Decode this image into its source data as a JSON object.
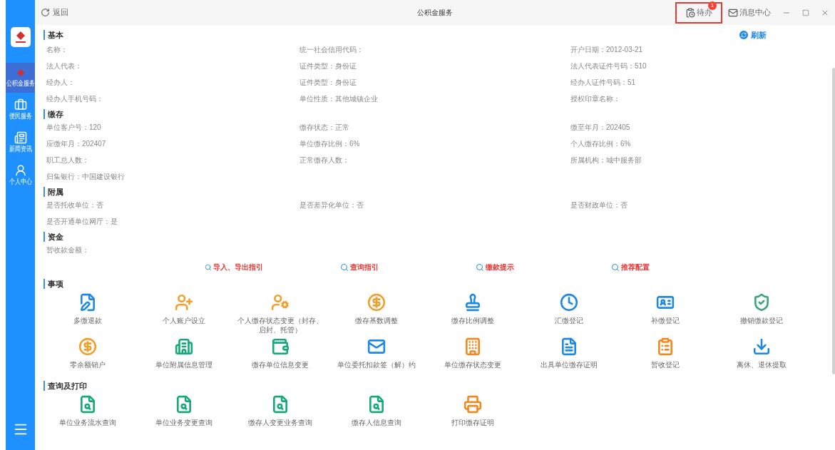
{
  "top_bar": {
    "back_label": "返回",
    "title": "公积金服务",
    "todo": {
      "label": "待办",
      "badge": "1",
      "highlighted": true
    },
    "messages_label": "消息中心"
  },
  "sidebar": {
    "items": [
      {
        "label": "公积金服务",
        "selected": true
      },
      {
        "label": "便民服务",
        "selected": false
      },
      {
        "label": "新闻资讯",
        "selected": false
      },
      {
        "label": "个人中心",
        "selected": false
      }
    ]
  },
  "sections": [
    {
      "title": "基本",
      "action": "刷新",
      "fields": [
        "名称：",
        "统一社会信用代码：",
        "开户日期：2012-03-21",
        "法人代表：",
        "证件类型：身份证",
        "法人代表证件号码：510",
        "经办人：",
        "证件类型：身份证",
        "经办人证件号码：51",
        "经办人手机号码：",
        "单位性质：其他城镇企业",
        "授权印章名称："
      ]
    },
    {
      "title": "缴存",
      "fields": [
        "单位客户号：120",
        "缴存状态：正常",
        "缴至年月：202405",
        "应缴年月：202407",
        "单位缴存比例：6%",
        "个人缴存比例：6%",
        "职工总人数：",
        "正常缴存人数：",
        "所属机构：城中服务部",
        "归集银行：中国建设银行"
      ]
    },
    {
      "title": "附属",
      "fields": [
        "是否托收单位：否",
        "是否差异化单位：否",
        "是否财政单位：否",
        "是否开通单位网厅：是"
      ]
    },
    {
      "title": "资金",
      "fields": [
        "暂收款金额："
      ],
      "links": [
        "导入、导出指引",
        "查询指引",
        "缴款提示",
        "推荐配置"
      ]
    },
    {
      "title": "事项",
      "tiles": [
        "多缴退款",
        "个人账户设立",
        "个人缴存状态变更（封存、启封、托管）",
        "缴存基数调整",
        "缴存比例调整",
        "汇缴登记",
        "补缴登记",
        "撤销缴款登记",
        "零余额销户",
        "单位附属信息管理",
        "缴存单位信息变更",
        "单位委托扣款签（解）约",
        "单位缴存状态变更",
        "出具单位缴存证明",
        "暂收登记",
        "离休、退休提取"
      ]
    },
    {
      "title": "查询及打印",
      "tiles": [
        "单位业务流水查询",
        "单位业务变更查询",
        "缴存人变更业务查询",
        "缴存人信息查询",
        "打印缴存证明"
      ]
    }
  ]
}
